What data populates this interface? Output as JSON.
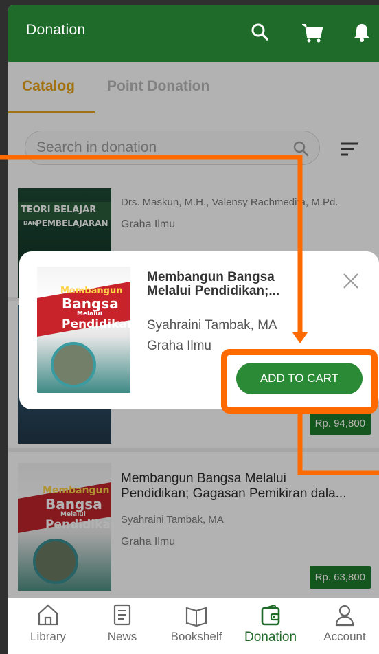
{
  "header": {
    "title": "Donation"
  },
  "tabs": [
    {
      "label": "Catalog",
      "active": true
    },
    {
      "label": "Point Donation",
      "active": false
    }
  ],
  "search": {
    "placeholder": "Search in donation"
  },
  "list": [
    {
      "authors": "Drs. Maskun, M.H., Valensy Rachmedita, M.Pd.",
      "publisher": "Graha Ilmu",
      "cover_line1": "TEORI BELAJAR",
      "cover_line2": "PEMBELAJARAN",
      "cover_small": "DAN"
    },
    {
      "price": "Rp. 94,800"
    },
    {
      "title_line1": "Membangun Bangsa Melalui",
      "title_line2": "Pendidikan; Gagasan Pemikiran dala...",
      "author": "Syahraini Tambak, MA",
      "publisher": "Graha Ilmu",
      "price": "Rp. 63,800"
    }
  ],
  "cover": {
    "word1": "Membangun",
    "word2": "Bangsa",
    "word3": "Melalui",
    "word4": "Pendidikan"
  },
  "popup": {
    "title": "Membangun Bangsa Melalui Pendidikan;...",
    "author": "Syahraini Tambak, MA",
    "publisher": "Graha Ilmu",
    "add_to_cart": "ADD TO CART"
  },
  "nav": [
    {
      "label": "Library",
      "icon": "library-icon"
    },
    {
      "label": "News",
      "icon": "news-icon"
    },
    {
      "label": "Bookshelf",
      "icon": "bookshelf-icon"
    },
    {
      "label": "Donation",
      "icon": "donation-icon",
      "active": true
    },
    {
      "label": "Account",
      "icon": "account-icon"
    }
  ],
  "colors": {
    "brand": "#1f6b2a",
    "accent": "#e8a317",
    "annotation": "#ff6a00",
    "button": "#2a8a36"
  }
}
